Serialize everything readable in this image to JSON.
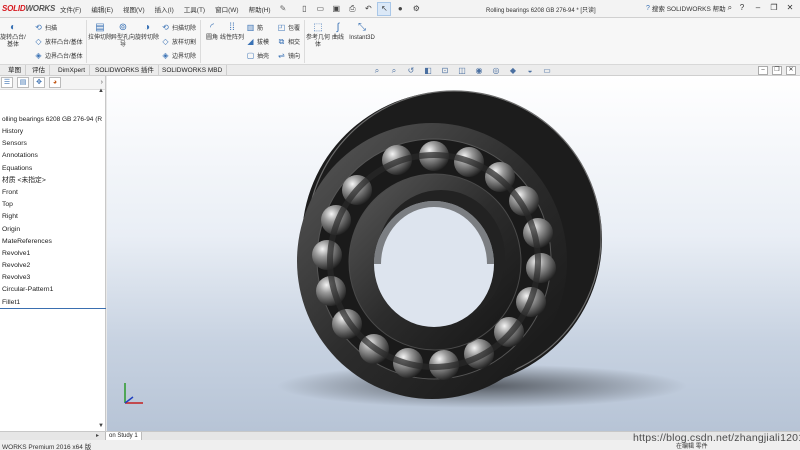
{
  "app": {
    "logo_main": "SOLID",
    "logo_accent": "WORKS",
    "doc_title": "Rolling bearings 6208 GB 276-94 * [只读]",
    "help_search": "搜索 SOLIDWORKS 帮助",
    "status": "WORKS Premium 2016 x64 版",
    "status_right": "在编辑 零件",
    "watermark": "https://blog.csdn.net/zhangjiali12011"
  },
  "menu": [
    "文件(F)",
    "编辑(E)",
    "视图(V)",
    "插入(I)",
    "工具(T)",
    "窗口(W)",
    "帮助(H)"
  ],
  "ribbon": {
    "big": [
      {
        "label": "旋转凸台/基体",
        "icon": "revolve-boss-icon"
      },
      {
        "label": "拉伸切除",
        "icon": "extruded-cut-icon"
      },
      {
        "label": "异型孔向导",
        "icon": "hole-wizard-icon"
      },
      {
        "label": "旋转切除",
        "icon": "revolved-cut-icon"
      },
      {
        "label": "圆角",
        "icon": "fillet-icon"
      },
      {
        "label": "线性阵列",
        "icon": "linear-pattern-icon"
      },
      {
        "label": "参考几何体",
        "icon": "reference-geometry-icon"
      },
      {
        "label": "曲线",
        "icon": "curves-icon"
      },
      {
        "label": "Instant3D",
        "icon": "instant3d-icon"
      }
    ],
    "small": [
      {
        "label": "扫描",
        "icon": "sweep-icon"
      },
      {
        "label": "放样凸台/基体",
        "icon": "loft-icon"
      },
      {
        "label": "边界凸台/基体",
        "icon": "boundary-boss-icon"
      },
      {
        "label": "扫描切除",
        "icon": "swept-cut-icon"
      },
      {
        "label": "放样切割",
        "icon": "lofted-cut-icon"
      },
      {
        "label": "边界切除",
        "icon": "boundary-cut-icon"
      },
      {
        "label": "筋",
        "icon": "rib-icon"
      },
      {
        "label": "拔模",
        "icon": "draft-icon"
      },
      {
        "label": "抽壳",
        "icon": "shell-icon"
      },
      {
        "label": "包覆",
        "icon": "wrap-icon"
      },
      {
        "label": "相交",
        "icon": "intersect-icon"
      },
      {
        "label": "镜向",
        "icon": "mirror-icon"
      }
    ]
  },
  "tabs": [
    "草图",
    "评估",
    "DimXpert",
    "SOLIDWORKS 插件",
    "SOLIDWORKS MBD"
  ],
  "tree": {
    "root": "olling bearings 6208 GB 276-94  (R",
    "items": [
      "History",
      "Sensors",
      "Annotations",
      "Equations",
      "材质 <未指定>",
      "Front",
      "Top",
      "Right",
      "Origin",
      "MateReferences",
      "Revolve1",
      "Revolve2",
      "Revolve3",
      "Circular-Pattern1",
      "Fillet1"
    ]
  },
  "bottom_tab": "on Study 1",
  "colors": {
    "accent": "#d71920",
    "selection": "#3a6fb0",
    "bearing": "#2b2b2b"
  }
}
